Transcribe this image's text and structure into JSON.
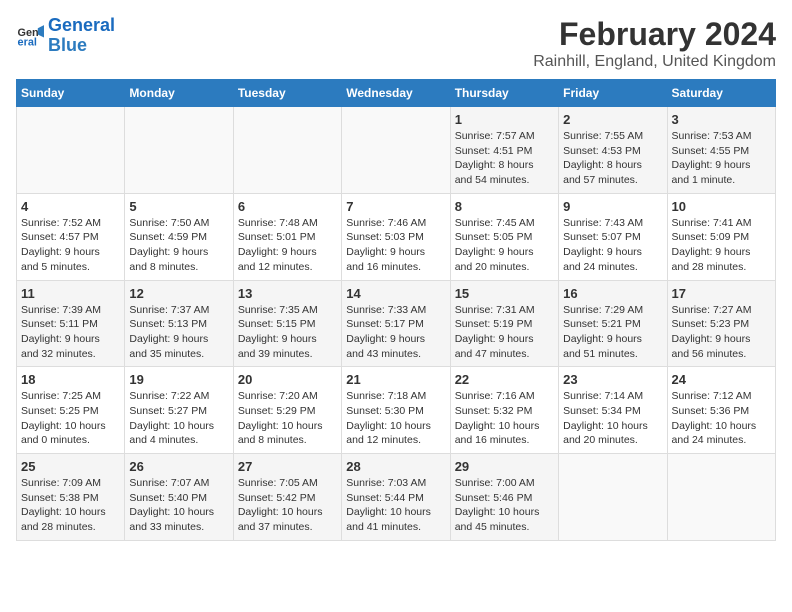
{
  "logo": {
    "line1": "General",
    "line2": "Blue"
  },
  "title": "February 2024",
  "subtitle": "Rainhill, England, United Kingdom",
  "days_of_week": [
    "Sunday",
    "Monday",
    "Tuesday",
    "Wednesday",
    "Thursday",
    "Friday",
    "Saturday"
  ],
  "weeks": [
    [
      {
        "day": "",
        "info": ""
      },
      {
        "day": "",
        "info": ""
      },
      {
        "day": "",
        "info": ""
      },
      {
        "day": "",
        "info": ""
      },
      {
        "day": "1",
        "info": "Sunrise: 7:57 AM\nSunset: 4:51 PM\nDaylight: 8 hours\nand 54 minutes."
      },
      {
        "day": "2",
        "info": "Sunrise: 7:55 AM\nSunset: 4:53 PM\nDaylight: 8 hours\nand 57 minutes."
      },
      {
        "day": "3",
        "info": "Sunrise: 7:53 AM\nSunset: 4:55 PM\nDaylight: 9 hours\nand 1 minute."
      }
    ],
    [
      {
        "day": "4",
        "info": "Sunrise: 7:52 AM\nSunset: 4:57 PM\nDaylight: 9 hours\nand 5 minutes."
      },
      {
        "day": "5",
        "info": "Sunrise: 7:50 AM\nSunset: 4:59 PM\nDaylight: 9 hours\nand 8 minutes."
      },
      {
        "day": "6",
        "info": "Sunrise: 7:48 AM\nSunset: 5:01 PM\nDaylight: 9 hours\nand 12 minutes."
      },
      {
        "day": "7",
        "info": "Sunrise: 7:46 AM\nSunset: 5:03 PM\nDaylight: 9 hours\nand 16 minutes."
      },
      {
        "day": "8",
        "info": "Sunrise: 7:45 AM\nSunset: 5:05 PM\nDaylight: 9 hours\nand 20 minutes."
      },
      {
        "day": "9",
        "info": "Sunrise: 7:43 AM\nSunset: 5:07 PM\nDaylight: 9 hours\nand 24 minutes."
      },
      {
        "day": "10",
        "info": "Sunrise: 7:41 AM\nSunset: 5:09 PM\nDaylight: 9 hours\nand 28 minutes."
      }
    ],
    [
      {
        "day": "11",
        "info": "Sunrise: 7:39 AM\nSunset: 5:11 PM\nDaylight: 9 hours\nand 32 minutes."
      },
      {
        "day": "12",
        "info": "Sunrise: 7:37 AM\nSunset: 5:13 PM\nDaylight: 9 hours\nand 35 minutes."
      },
      {
        "day": "13",
        "info": "Sunrise: 7:35 AM\nSunset: 5:15 PM\nDaylight: 9 hours\nand 39 minutes."
      },
      {
        "day": "14",
        "info": "Sunrise: 7:33 AM\nSunset: 5:17 PM\nDaylight: 9 hours\nand 43 minutes."
      },
      {
        "day": "15",
        "info": "Sunrise: 7:31 AM\nSunset: 5:19 PM\nDaylight: 9 hours\nand 47 minutes."
      },
      {
        "day": "16",
        "info": "Sunrise: 7:29 AM\nSunset: 5:21 PM\nDaylight: 9 hours\nand 51 minutes."
      },
      {
        "day": "17",
        "info": "Sunrise: 7:27 AM\nSunset: 5:23 PM\nDaylight: 9 hours\nand 56 minutes."
      }
    ],
    [
      {
        "day": "18",
        "info": "Sunrise: 7:25 AM\nSunset: 5:25 PM\nDaylight: 10 hours\nand 0 minutes."
      },
      {
        "day": "19",
        "info": "Sunrise: 7:22 AM\nSunset: 5:27 PM\nDaylight: 10 hours\nand 4 minutes."
      },
      {
        "day": "20",
        "info": "Sunrise: 7:20 AM\nSunset: 5:29 PM\nDaylight: 10 hours\nand 8 minutes."
      },
      {
        "day": "21",
        "info": "Sunrise: 7:18 AM\nSunset: 5:30 PM\nDaylight: 10 hours\nand 12 minutes."
      },
      {
        "day": "22",
        "info": "Sunrise: 7:16 AM\nSunset: 5:32 PM\nDaylight: 10 hours\nand 16 minutes."
      },
      {
        "day": "23",
        "info": "Sunrise: 7:14 AM\nSunset: 5:34 PM\nDaylight: 10 hours\nand 20 minutes."
      },
      {
        "day": "24",
        "info": "Sunrise: 7:12 AM\nSunset: 5:36 PM\nDaylight: 10 hours\nand 24 minutes."
      }
    ],
    [
      {
        "day": "25",
        "info": "Sunrise: 7:09 AM\nSunset: 5:38 PM\nDaylight: 10 hours\nand 28 minutes."
      },
      {
        "day": "26",
        "info": "Sunrise: 7:07 AM\nSunset: 5:40 PM\nDaylight: 10 hours\nand 33 minutes."
      },
      {
        "day": "27",
        "info": "Sunrise: 7:05 AM\nSunset: 5:42 PM\nDaylight: 10 hours\nand 37 minutes."
      },
      {
        "day": "28",
        "info": "Sunrise: 7:03 AM\nSunset: 5:44 PM\nDaylight: 10 hours\nand 41 minutes."
      },
      {
        "day": "29",
        "info": "Sunrise: 7:00 AM\nSunset: 5:46 PM\nDaylight: 10 hours\nand 45 minutes."
      },
      {
        "day": "",
        "info": ""
      },
      {
        "day": "",
        "info": ""
      }
    ]
  ]
}
